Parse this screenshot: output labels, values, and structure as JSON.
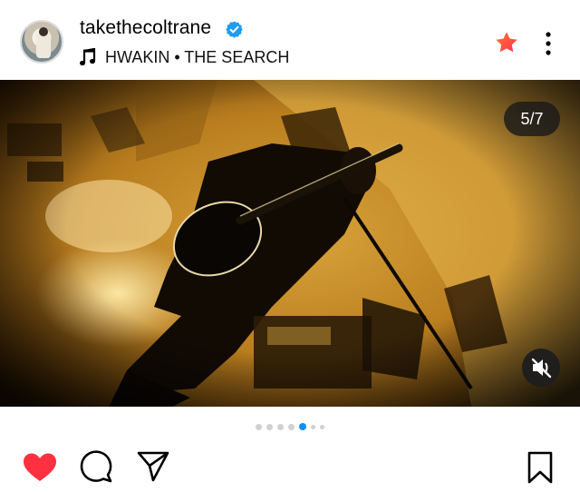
{
  "post": {
    "username": "takethecoltrane",
    "music": "HWAKIN • THE SEARCH",
    "carousel": {
      "counter": "5/7",
      "current": 5,
      "total": 7
    },
    "icons": {
      "verified": "verified-badge-icon",
      "music": "music-note-icon",
      "favorite": "star-icon",
      "more": "more-options-icon",
      "mute": "sound-off-icon",
      "like": "heart-icon",
      "comment": "comment-icon",
      "share": "send-icon",
      "save": "bookmark-icon"
    },
    "colors": {
      "verified": "#1d9bf0",
      "star": "#ff4a4a",
      "like": "#ff3040",
      "active_dot": "#1a8cf0"
    }
  }
}
